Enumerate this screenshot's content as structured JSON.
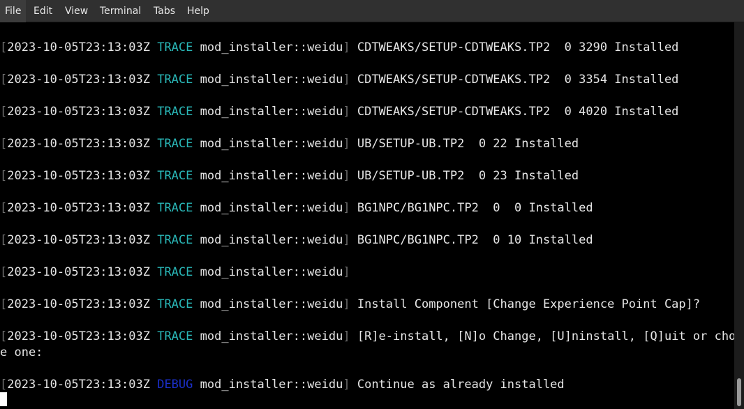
{
  "menu": [
    "File",
    "Edit",
    "View",
    "Terminal",
    "Tabs",
    "Help"
  ],
  "log_lines": [
    {
      "ts": "2023-10-05T23:13:03Z",
      "level": "TRACE",
      "target": "mod_installer::weidu",
      "msg": "CDTWEAKS/SETUP-CDTWEAKS.TP2  0 3290 Installed"
    },
    {
      "ts": "2023-10-05T23:13:03Z",
      "level": "TRACE",
      "target": "mod_installer::weidu",
      "msg": "CDTWEAKS/SETUP-CDTWEAKS.TP2  0 3354 Installed"
    },
    {
      "ts": "2023-10-05T23:13:03Z",
      "level": "TRACE",
      "target": "mod_installer::weidu",
      "msg": "CDTWEAKS/SETUP-CDTWEAKS.TP2  0 4020 Installed"
    },
    {
      "ts": "2023-10-05T23:13:03Z",
      "level": "TRACE",
      "target": "mod_installer::weidu",
      "msg": "UB/SETUP-UB.TP2  0 22 Installed"
    },
    {
      "ts": "2023-10-05T23:13:03Z",
      "level": "TRACE",
      "target": "mod_installer::weidu",
      "msg": "UB/SETUP-UB.TP2  0 23 Installed"
    },
    {
      "ts": "2023-10-05T23:13:03Z",
      "level": "TRACE",
      "target": "mod_installer::weidu",
      "msg": "BG1NPC/BG1NPC.TP2  0  0 Installed"
    },
    {
      "ts": "2023-10-05T23:13:03Z",
      "level": "TRACE",
      "target": "mod_installer::weidu",
      "msg": "BG1NPC/BG1NPC.TP2  0 10 Installed"
    },
    {
      "ts": "2023-10-05T23:13:03Z",
      "level": "TRACE",
      "target": "mod_installer::weidu",
      "msg": ""
    },
    {
      "ts": "2023-10-05T23:13:03Z",
      "level": "TRACE",
      "target": "mod_installer::weidu",
      "msg": "Install Component [Change Experience Point Cap]?"
    },
    {
      "ts": "2023-10-05T23:13:03Z",
      "level": "TRACE",
      "target": "mod_installer::weidu",
      "msg": "[R]e-install, [N]o Change, [U]ninstall, [Q]uit or choos"
    },
    {
      "ts": "2023-10-05T23:13:03Z",
      "level": "DEBUG",
      "target": "mod_installer::weidu",
      "msg": "Continue as already installed"
    }
  ],
  "wrap_line": "e one:"
}
